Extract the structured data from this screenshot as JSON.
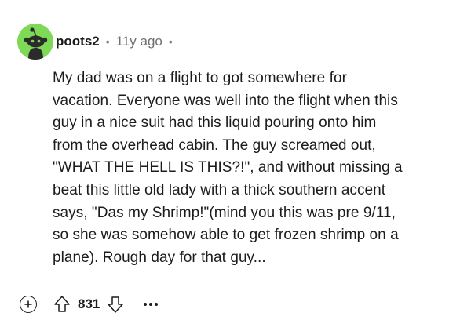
{
  "comment": {
    "author": "poots2",
    "separator": "•",
    "age": "11y ago",
    "trailing_separator": "•",
    "avatar_color": "#7ed957",
    "avatar_icon": "reddit-snoo-avatar-icon",
    "body_lines": [
      "My dad was on a flight to got somewhere for",
      "vacation. Everyone was well into the flight when this",
      "guy in a nice suit had this liquid pouring onto him",
      "from the overhead cabin. The guy screamed out,",
      "\"WHAT THE HELL IS THIS?!\", and without missing a",
      "beat this little old lady with a thick southern accent",
      "says, \"Das my Shrimp!\"(mind you this was pre 9/11,",
      "so she was somehow able to get frozen shrimp on a",
      "plane). Rough day for that guy..."
    ]
  },
  "actions": {
    "expand_icon": "plus-circle-icon",
    "upvote_icon": "arrow-up-icon",
    "score": "831",
    "downvote_icon": "arrow-down-icon",
    "more_icon": "ellipsis-icon"
  }
}
